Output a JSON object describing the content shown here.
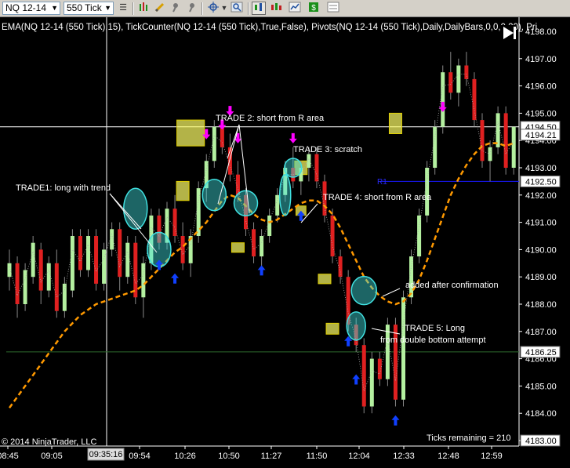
{
  "toolbar": {
    "instrument": "NQ 12-14",
    "period": "550 Tick",
    "icons": [
      "hamburger-icon",
      "bar-chart-icon",
      "candlestick-icon",
      "pencil-icon",
      "pin-icon",
      "pin-arrow-icon",
      "crosshair-icon",
      "magnifier-icon",
      "data-box-icon",
      "chart-style-icon",
      "chart-trader-icon",
      "strategy-icon",
      "properties-icon"
    ]
  },
  "indicator_label": "EMA(NQ 12-14 (550 Tick),15), TickCounter(NQ 12-14 (550 Tick),True,False), Pivots(NQ 12-14 (550 Tick),Daily,DailyBars,0,0,0,20), Pri",
  "copyright": "© 2014 NinjaTrader, LLC",
  "ticks_remaining": "Ticks remaining = 210",
  "crosshair_time": "09:35:16",
  "x_labels": [
    "08:45",
    "09:05",
    "09:54",
    "10:26",
    "10:50",
    "11:27",
    "11:50",
    "12:04",
    "12:33",
    "12:48",
    "12:59"
  ],
  "price_labels": [
    "4198.00",
    "4197.00",
    "4196.00",
    "4195.00",
    "4194.00",
    "4193.00",
    "4192.00",
    "4191.00",
    "4190.00",
    "4189.00",
    "4188.00",
    "4187.00",
    "4186.00",
    "4185.00",
    "4184.00",
    "4183.00"
  ],
  "price_flags": [
    {
      "text": "4194.50",
      "bg": "#ffffff",
      "fg": "#000000"
    },
    {
      "text": "4194.21",
      "bg": "#ffffff",
      "fg": "#000000"
    },
    {
      "text": "4192.50",
      "bg": "#ffffff",
      "fg": "#000000"
    },
    {
      "text": "4186.25",
      "bg": "#ffffff",
      "fg": "#000000"
    },
    {
      "text": "4183.00",
      "bg": "#ffffff",
      "fg": "#000000"
    }
  ],
  "pivot_label": "R1",
  "annotations": [
    "TRADE1: long with trend",
    "TRADE 2: short from R area",
    "TRADE 3: scratch",
    "TRADE 4: short from R area",
    "added after confirmation",
    "TRADE 5: Long",
    "from double bottom attempt"
  ],
  "colors": {
    "up_candle": "#b4f0a0",
    "down_candle": "#e02020",
    "ema": "#ff9900",
    "pivot_r1": "#1a1aff",
    "support_line": "#2e6b2e",
    "short_arrow": "#ff00ff",
    "long_arrow": "#1040ff",
    "highlight_box": "#ffff66",
    "ellipse": "#40e0e0"
  },
  "chart_data": {
    "type": "candlestick",
    "y_unit": "price",
    "ylim": [
      4183.0,
      4198.5
    ],
    "pivot_r1": 4192.5,
    "support_level": 4186.25,
    "current_price": 4194.5,
    "candles": [
      [
        4189,
        4190,
        4188.5,
        4189.5
      ],
      [
        4189.5,
        4189.75,
        4187.5,
        4188
      ],
      [
        4188,
        4189.5,
        4187.75,
        4189.25
      ],
      [
        4189,
        4190.5,
        4188.75,
        4190.25
      ],
      [
        4190,
        4190.25,
        4188,
        4188.5
      ],
      [
        4188.5,
        4189.75,
        4188.25,
        4189.5
      ],
      [
        4189.5,
        4190,
        4187.5,
        4187.75
      ],
      [
        4187.75,
        4189,
        4187.5,
        4188.75
      ],
      [
        4188.5,
        4190.75,
        4188.25,
        4190.5
      ],
      [
        4190.5,
        4190.75,
        4189,
        4189.25
      ],
      [
        4189.25,
        4190.75,
        4189,
        4190.5
      ],
      [
        4190.5,
        4190.75,
        4188.5,
        4188.75
      ],
      [
        4188.75,
        4190.25,
        4188.5,
        4190
      ],
      [
        4190,
        4191,
        4189.75,
        4190.75
      ],
      [
        4190.75,
        4191,
        4188.5,
        4189
      ],
      [
        4189,
        4190.5,
        4188.75,
        4190.25
      ],
      [
        4190.25,
        4190.5,
        4188,
        4188.25
      ],
      [
        4188.25,
        4189.75,
        4187.5,
        4189.5
      ],
      [
        4189.5,
        4191.5,
        4189.25,
        4191.25
      ],
      [
        4191.25,
        4191.5,
        4190,
        4190.25
      ],
      [
        4190.25,
        4191.75,
        4190,
        4191.5
      ],
      [
        4191.5,
        4192,
        4190.25,
        4190.5
      ],
      [
        4190.5,
        4191,
        4189.25,
        4189.5
      ],
      [
        4189.5,
        4190.75,
        4189,
        4190.5
      ],
      [
        4190.5,
        4192.5,
        4190.25,
        4192.25
      ],
      [
        4192.25,
        4193.5,
        4191.75,
        4193.25
      ],
      [
        4193.25,
        4194.75,
        4193,
        4194.5
      ],
      [
        4194.5,
        4194.75,
        4193.5,
        4193.75
      ],
      [
        4193.75,
        4194.25,
        4192.5,
        4192.75
      ],
      [
        4192.75,
        4193.25,
        4191.75,
        4192
      ],
      [
        4192,
        4192.25,
        4190.5,
        4190.75
      ],
      [
        4190.75,
        4191,
        4189.5,
        4189.75
      ],
      [
        4189.75,
        4190.75,
        4189.25,
        4190.5
      ],
      [
        4190.5,
        4191.5,
        4190.25,
        4191.25
      ],
      [
        4191.25,
        4192.25,
        4191,
        4192
      ],
      [
        4192,
        4193.25,
        4191.75,
        4193
      ],
      [
        4193,
        4193.75,
        4192.25,
        4192.5
      ],
      [
        4192.5,
        4193.25,
        4192,
        4193
      ],
      [
        4193,
        4193.75,
        4192.5,
        4193.5
      ],
      [
        4193.5,
        4193.75,
        4192.25,
        4192.5
      ],
      [
        4192.5,
        4192.75,
        4191,
        4191.25
      ],
      [
        4191.25,
        4191.5,
        4189.5,
        4189.75
      ],
      [
        4189.75,
        4190,
        4188.75,
        4189
      ],
      [
        4189,
        4189.25,
        4187,
        4187.25
      ],
      [
        4187.25,
        4187.5,
        4186.25,
        4186.5
      ],
      [
        4186.5,
        4186.75,
        4184,
        4184.25
      ],
      [
        4184.25,
        4186.25,
        4184,
        4186
      ],
      [
        4186,
        4186.25,
        4185,
        4185.25
      ],
      [
        4185.25,
        4187.5,
        4185,
        4187.25
      ],
      [
        4187.25,
        4187.5,
        4184.25,
        4184.5
      ],
      [
        4184.5,
        4188.5,
        4184.25,
        4188.25
      ],
      [
        4188.25,
        4190,
        4188,
        4189.75
      ],
      [
        4189.75,
        4191.5,
        4189.5,
        4191.25
      ],
      [
        4191.25,
        4193.25,
        4191,
        4193
      ],
      [
        4193,
        4194.75,
        4192.75,
        4194.5
      ],
      [
        4194.5,
        4196.75,
        4194.25,
        4196.5
      ],
      [
        4196.5,
        4197.25,
        4195.5,
        4195.75
      ],
      [
        4195.75,
        4197,
        4195.25,
        4196.75
      ],
      [
        4196.75,
        4197.25,
        4196,
        4196.25
      ],
      [
        4196.25,
        4196.5,
        4194.5,
        4194.75
      ],
      [
        4194.75,
        4195,
        4193,
        4193.25
      ],
      [
        4193.25,
        4194,
        4192.5,
        4193.75
      ],
      [
        4193.75,
        4195.25,
        4193.5,
        4195
      ],
      [
        4195,
        4195.25,
        4192.75,
        4193
      ],
      [
        4193,
        4194.25,
        4192.75,
        4194.5
      ]
    ],
    "ema": [
      4184.2,
      4184.6,
      4185,
      4185.4,
      4185.8,
      4186.2,
      4186.6,
      4187,
      4187.3,
      4187.6,
      4187.8,
      4188,
      4188.1,
      4188.2,
      4188.3,
      4188.4,
      4188.5,
      4188.7,
      4189,
      4189.3,
      4189.6,
      4189.9,
      4190.1,
      4190.4,
      4190.7,
      4191,
      4191.4,
      4191.8,
      4192,
      4191.9,
      4191.6,
      4191.3,
      4191.1,
      4191,
      4191.1,
      4191.3,
      4191.5,
      4191.7,
      4191.8,
      4191.8,
      4191.6,
      4191.3,
      4190.8,
      4190.2,
      4189.6,
      4189,
      4188.6,
      4188.3,
      4188.1,
      4188,
      4188.1,
      4188.4,
      4188.9,
      4189.6,
      4190.4,
      4191.2,
      4192,
      4192.6,
      4193.1,
      4193.5,
      4193.8,
      4193.9,
      4193.9,
      4193.8,
      4193.9
    ],
    "markers": [
      {
        "type": "short",
        "index": 28,
        "price": 4194.75
      },
      {
        "type": "short",
        "index": 27,
        "price": 4194.25
      },
      {
        "type": "short",
        "index": 25,
        "price": 4193.9
      },
      {
        "type": "short",
        "index": 29,
        "price": 4193.75
      },
      {
        "type": "short",
        "index": 36,
        "price": 4193.75
      },
      {
        "type": "short",
        "index": 55,
        "price": 4194.9
      },
      {
        "type": "long",
        "index": 19,
        "price": 4189.8
      },
      {
        "type": "long",
        "index": 21,
        "price": 4189.3
      },
      {
        "type": "long",
        "index": 32,
        "price": 4189.6
      },
      {
        "type": "long",
        "index": 37,
        "price": 4191.6
      },
      {
        "type": "long",
        "index": 43,
        "price": 4187.0
      },
      {
        "type": "long",
        "index": 44,
        "price": 4185.6
      },
      {
        "type": "long",
        "index": 49,
        "price": 4184.1
      }
    ]
  }
}
